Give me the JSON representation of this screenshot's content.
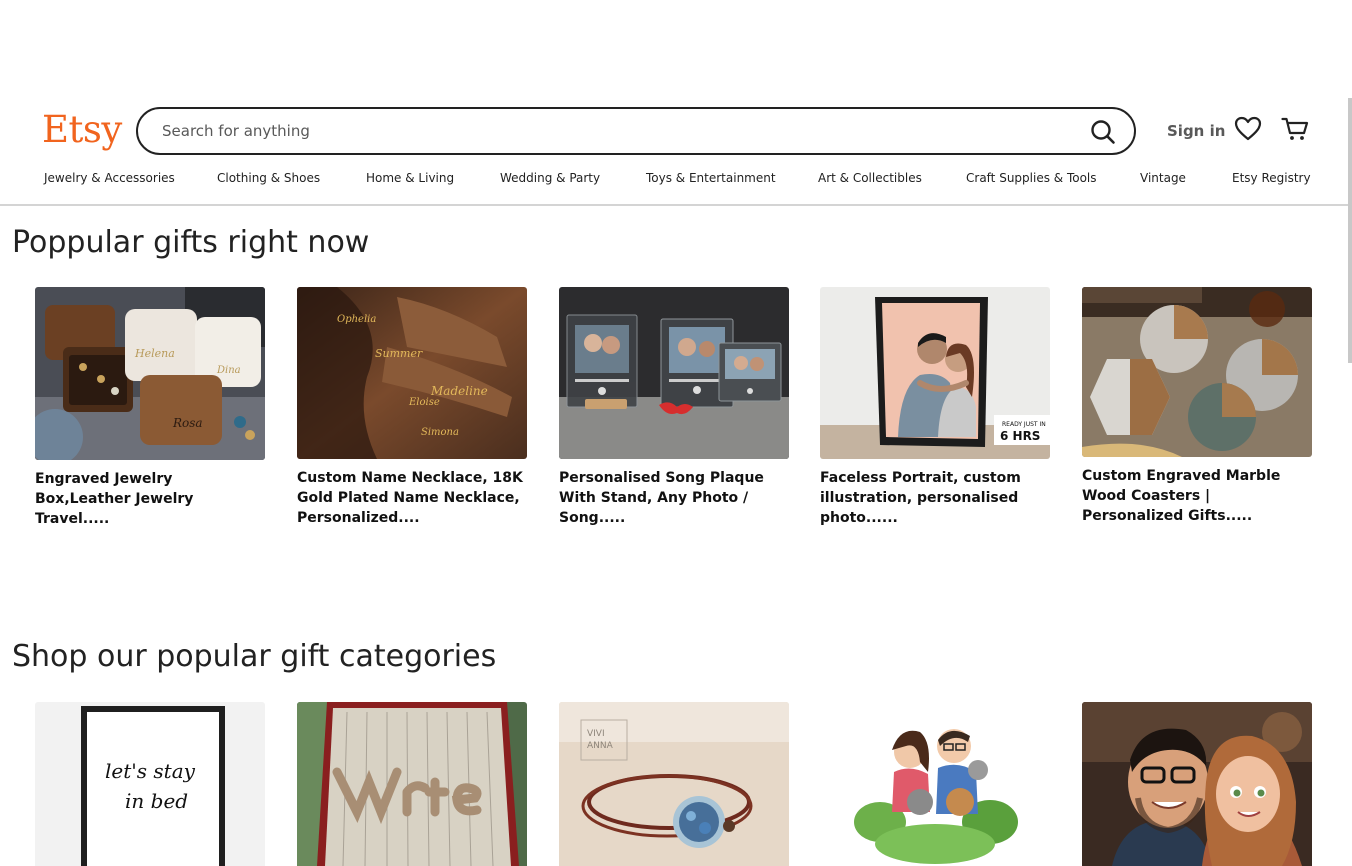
{
  "header": {
    "logo": "Etsy",
    "search_placeholder": "Search for anything",
    "sign_in": "Sign in",
    "nav": [
      "Jewelry & Accessories",
      "Clothing & Shoes",
      "Home & Living",
      "Wedding & Party",
      "Toys & Entertainment",
      "Art & Collectibles",
      "Craft Supplies & Tools",
      "Vintage",
      "Etsy Registry"
    ]
  },
  "popular": {
    "title": "Poppular gifts right now",
    "items": [
      {
        "title": "Engraved Jewelry Box,Leather Jewelry Travel....."
      },
      {
        "title": "Custom Name Necklace, 18K Gold Plated Name Necklace, Personalized...."
      },
      {
        "title": "Personalised Song Plaque With Stand, Any Photo / Song....."
      },
      {
        "title": "Faceless Portrait, custom illustration, personalised photo......",
        "badge": "6 HRS"
      },
      {
        "title": "Custom Engraved Marble Wood Coasters | Personalized Gifts....."
      }
    ]
  },
  "categories": {
    "title": "Shop our popular gift categories",
    "print_text": [
      "let's stay",
      "in bed"
    ],
    "bracelet_brand": [
      "VIVI",
      "ANNA"
    ]
  },
  "colors": {
    "brand": "#f1641e",
    "text": "#222222"
  }
}
